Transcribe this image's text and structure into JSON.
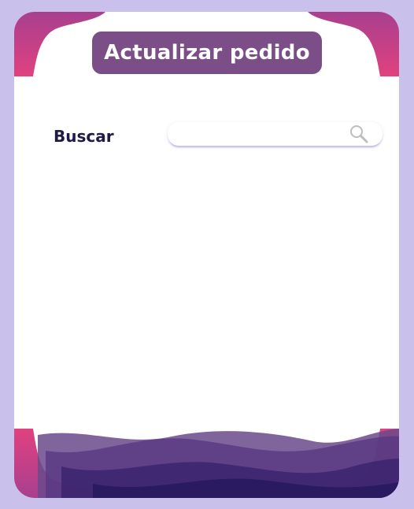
{
  "header": {
    "title": "Actualizar pedido"
  },
  "search": {
    "label": "Buscar",
    "value": "",
    "placeholder": "",
    "icon": "search-icon"
  },
  "colors": {
    "page_background": "#c9c0ec",
    "card_background": "#ffffff",
    "title_pill": "#7b4e88",
    "title_text": "#ffffff",
    "label_text": "#1f1a47",
    "corner_pink": "#d63a86",
    "corner_purple": "#9b3a8e",
    "wave_dark": "#2f1a63",
    "wave_mid": "#5a2f7a"
  }
}
